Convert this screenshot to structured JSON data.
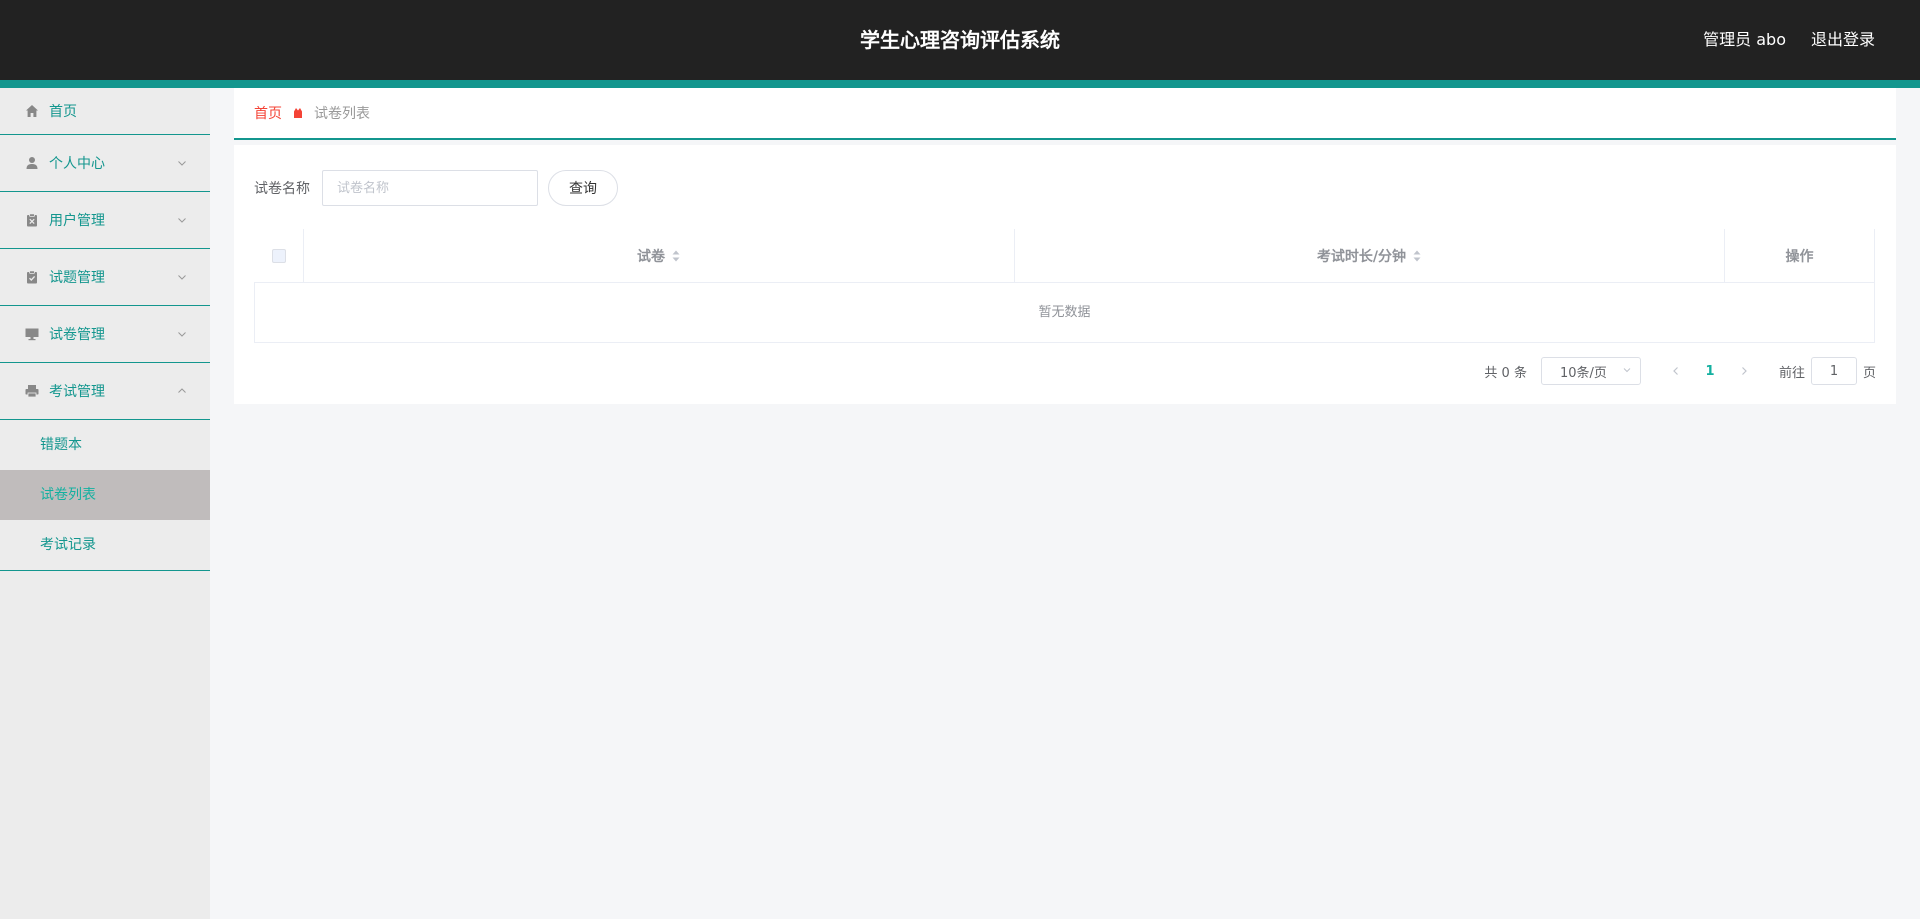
{
  "header": {
    "title": "学生心理咨询评估系统",
    "user": "管理员 abo",
    "logout": "退出登录"
  },
  "sidebar": {
    "items": [
      {
        "label": "首页",
        "icon": "home-icon"
      },
      {
        "label": "个人中心",
        "icon": "user-icon",
        "expanded": false
      },
      {
        "label": "用户管理",
        "icon": "clipboard-icon",
        "expanded": false
      },
      {
        "label": "试题管理",
        "icon": "clipboard-check-icon",
        "expanded": false
      },
      {
        "label": "试卷管理",
        "icon": "monitor-icon",
        "expanded": false
      },
      {
        "label": "考试管理",
        "icon": "printer-icon",
        "expanded": true
      }
    ],
    "subitems": [
      {
        "label": "错题本",
        "active": false
      },
      {
        "label": "试卷列表",
        "active": true
      },
      {
        "label": "考试记录",
        "active": false
      }
    ]
  },
  "breadcrumb": {
    "home": "首页",
    "current": "试卷列表"
  },
  "search": {
    "label": "试卷名称",
    "placeholder": "试卷名称",
    "value": "",
    "button": "查询"
  },
  "table": {
    "columns": [
      "试卷",
      "考试时长/分钟",
      "操作"
    ],
    "empty_text": "暂无数据"
  },
  "pagination": {
    "total_text": "共 0 条",
    "page_size": "10条/页",
    "current_page": "1",
    "goto_label": "前往",
    "goto_value": "1",
    "goto_suffix": "页"
  },
  "colors": {
    "accent": "#13968e",
    "topbar": "#222222",
    "active_bg": "#c0bcbc",
    "breadcrumb_home": "#f44336"
  }
}
